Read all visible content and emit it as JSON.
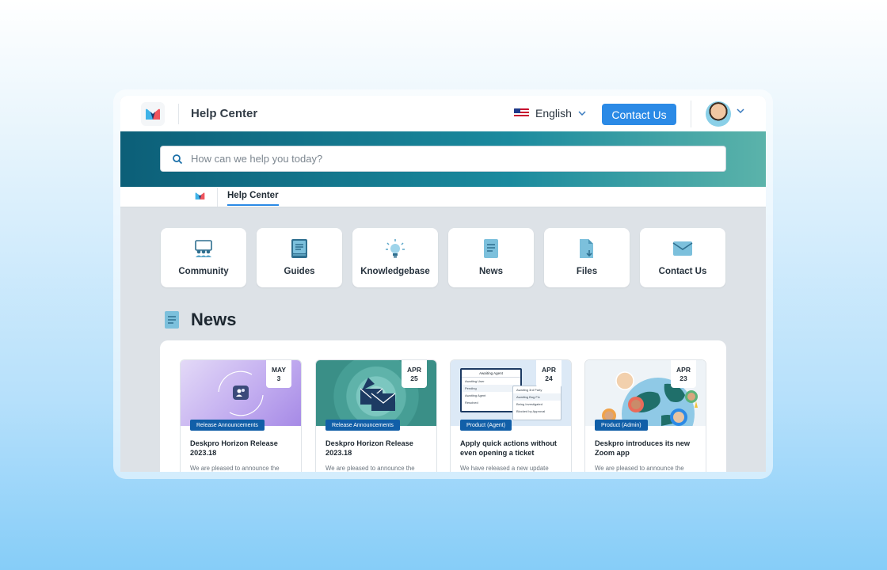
{
  "header": {
    "title": "Help Center",
    "language": "English",
    "contact_button": "Contact Us"
  },
  "search": {
    "placeholder": "How can we help you today?"
  },
  "breadcrumb": {
    "current": "Help Center"
  },
  "categories": [
    {
      "label": "Community",
      "icon": "community-icon"
    },
    {
      "label": "Guides",
      "icon": "guide-book-icon"
    },
    {
      "label": "Knowledgebase",
      "icon": "lightbulb-icon"
    },
    {
      "label": "News",
      "icon": "news-document-icon"
    },
    {
      "label": "Files",
      "icon": "file-download-icon"
    },
    {
      "label": "Contact Us",
      "icon": "envelope-icon"
    }
  ],
  "news": {
    "heading": "News",
    "articles": [
      {
        "month": "MAY",
        "day": "3",
        "tag": "Release Announcements",
        "title": "Deskpro Horizon Release 2023.18",
        "excerpt": "We are pleased to announce the"
      },
      {
        "month": "APR",
        "day": "25",
        "tag": "Release Announcements",
        "title": "Deskpro Horizon Release 2023.18",
        "excerpt": "We are pleased to announce the"
      },
      {
        "month": "APR",
        "day": "24",
        "tag": "Product (Agent)",
        "title": "Apply quick actions without even opening a ticket",
        "excerpt": "We have released a new update"
      },
      {
        "month": "APR",
        "day": "23",
        "tag": "Product (Admin)",
        "title": "Deskpro introduces its new Zoom app",
        "excerpt": "We are pleased to announce the"
      }
    ],
    "thumb3_menu": {
      "header": "Awaiting Agent",
      "left_items": [
        "Awaiting User",
        "Pending",
        "Awaiting Agent",
        "Resolved"
      ],
      "right_items": [
        "Awaiting 3rd Party",
        "Awaiting Bug Fix",
        "Being Investigated",
        "Blocked by Approval"
      ]
    }
  },
  "colors": {
    "accent": "#2b8ae6",
    "tag": "#115fa8",
    "hero_start": "#0c5f78",
    "hero_end": "#5bb3aa"
  }
}
